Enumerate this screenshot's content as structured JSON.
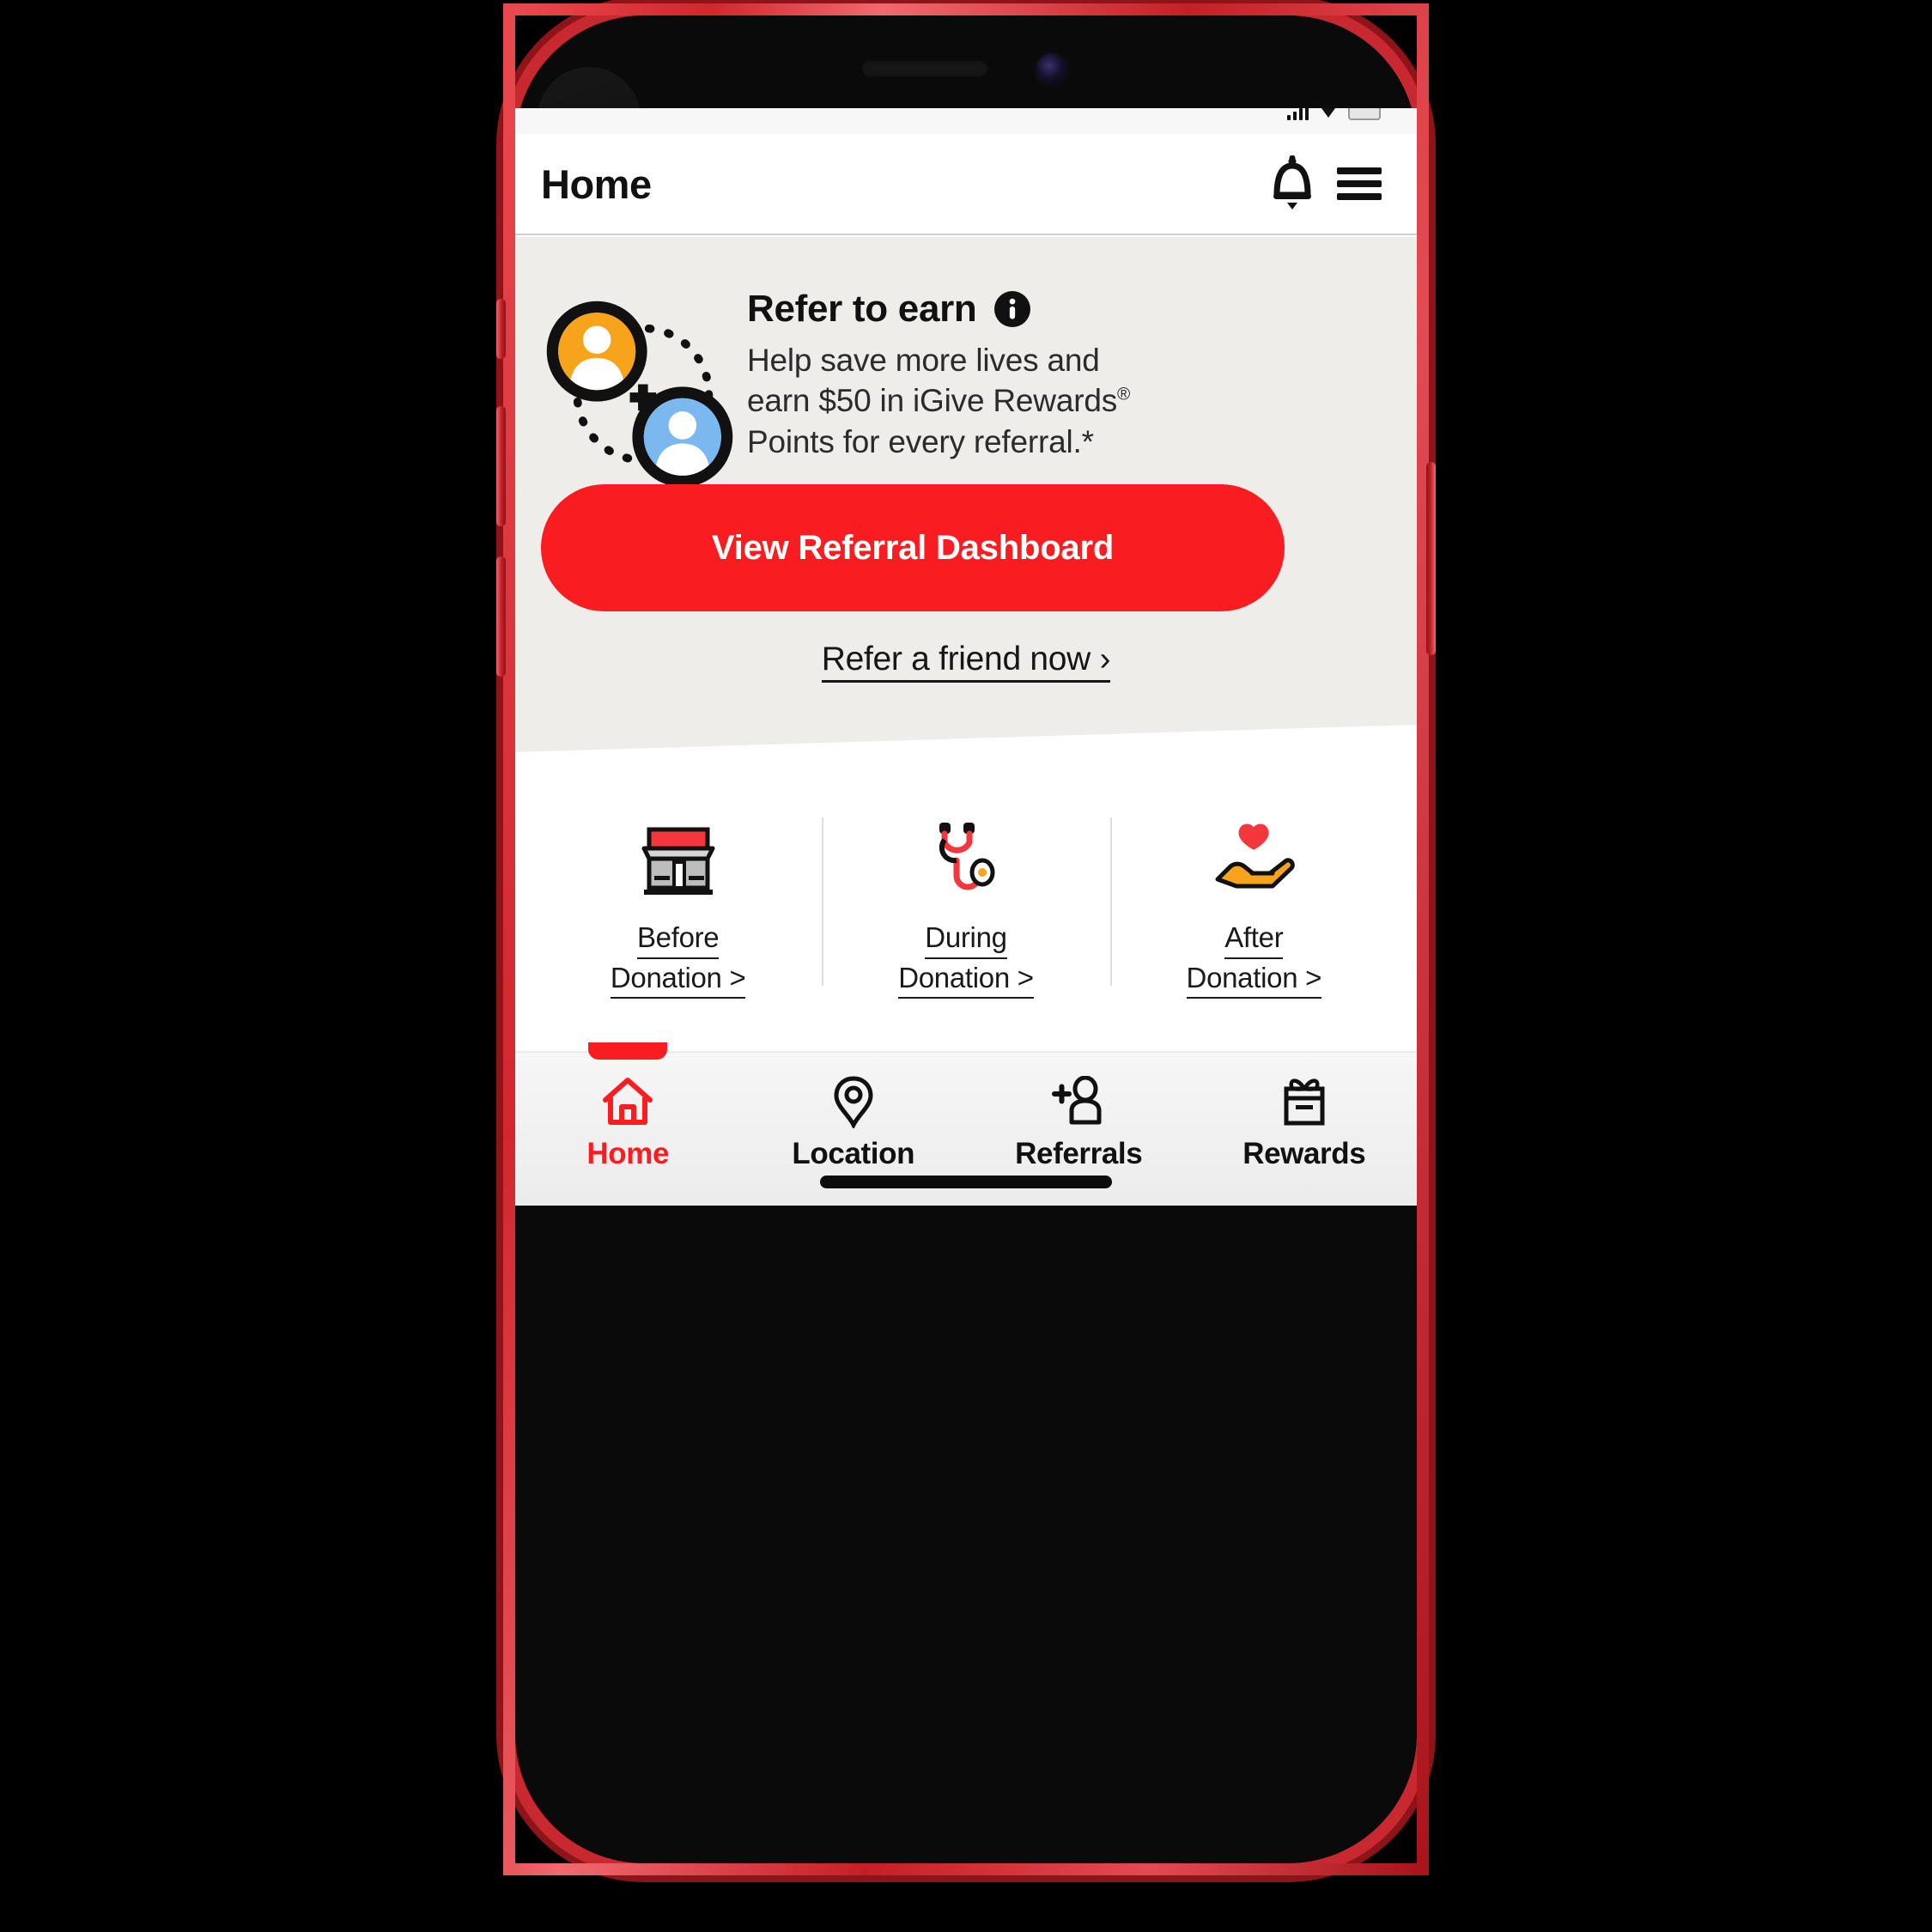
{
  "device": {
    "frame_color": "#c8282f",
    "body_color": "#0a0a0a"
  },
  "statusbar": {
    "signal_icon": "signal-bars-icon",
    "wifi_icon": "wifi-icon",
    "battery_icon": "battery-icon"
  },
  "header": {
    "title": "Home",
    "notifications_icon": "bell-icon",
    "menu_icon": "hamburger-menu-icon"
  },
  "hero": {
    "art_icon": "two-avatars-referral-icon",
    "title": "Refer to earn",
    "info_icon": "info-icon",
    "body_line1": "Help save more lives and",
    "body_line2_pre": "earn $50 in iGive Rewards",
    "body_line2_sup": "®",
    "body_line3": "Points for every referral.*",
    "cta_label": "View Referral Dashboard",
    "cta_color": "#f91d22",
    "link_label": "Refer a friend now ›",
    "background_color": "#efedea"
  },
  "stages": [
    {
      "icon": "storefront-icon",
      "line1": "Before",
      "line2": "Donation >"
    },
    {
      "icon": "stethoscope-icon",
      "line1": "During",
      "line2": "Donation >"
    },
    {
      "icon": "heart-in-hand-icon",
      "line1": "After",
      "line2": "Donation >"
    }
  ],
  "bottom_nav": {
    "active_color": "#f91d22",
    "items": [
      {
        "label": "Home",
        "icon": "home-icon",
        "active": true
      },
      {
        "label": "Location",
        "icon": "map-pin-icon",
        "active": false
      },
      {
        "label": "Referrals",
        "icon": "add-person-icon",
        "active": false
      },
      {
        "label": "Rewards",
        "icon": "gift-icon",
        "active": false
      }
    ]
  }
}
